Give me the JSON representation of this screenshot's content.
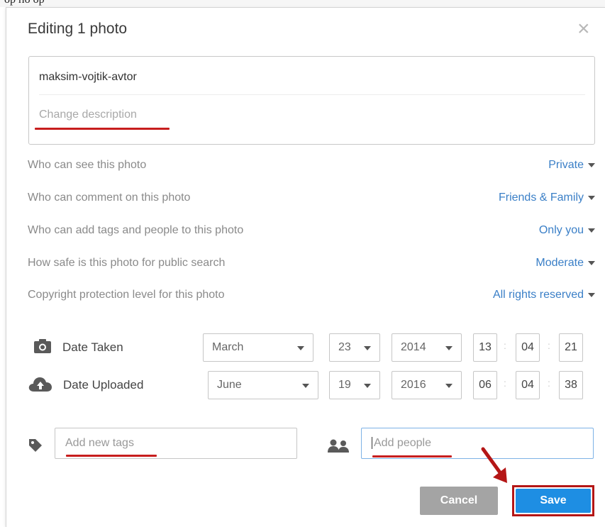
{
  "top_text": "ор по ор",
  "dialog": {
    "title": "Editing 1 photo",
    "close_glyph": "×"
  },
  "description": {
    "title_value": "maksim-vojtik-avtor",
    "placeholder": "Change description"
  },
  "settings": [
    {
      "label": "Who can see this photo",
      "value": "Private"
    },
    {
      "label": "Who can comment on this photo",
      "value": "Friends & Family"
    },
    {
      "label": "Who can add tags and people to this photo",
      "value": "Only you"
    },
    {
      "label": "How safe is this photo for public search",
      "value": "Moderate"
    },
    {
      "label": "Copyright protection level for this photo",
      "value": "All rights reserved"
    }
  ],
  "dates": {
    "taken": {
      "label": "Date Taken",
      "month": "March",
      "day": "23",
      "year": "2014",
      "hour": "13",
      "minute": "04",
      "second": "21",
      "icon": "camera-icon"
    },
    "uploaded": {
      "label": "Date Uploaded",
      "month": "June",
      "day": "19",
      "year": "2016",
      "hour": "06",
      "minute": "04",
      "second": "38",
      "icon": "cloud-upload-icon"
    }
  },
  "tags": {
    "placeholder": "Add new tags",
    "icon": "tag-icon"
  },
  "people": {
    "placeholder": "Add people",
    "icon": "people-icon"
  },
  "buttons": {
    "cancel": "Cancel",
    "save": "Save"
  },
  "colors": {
    "link": "#3a7fc7",
    "save": "#1e8ee3",
    "cancel": "#a4a4a4",
    "highlight": "#c71e1e"
  }
}
